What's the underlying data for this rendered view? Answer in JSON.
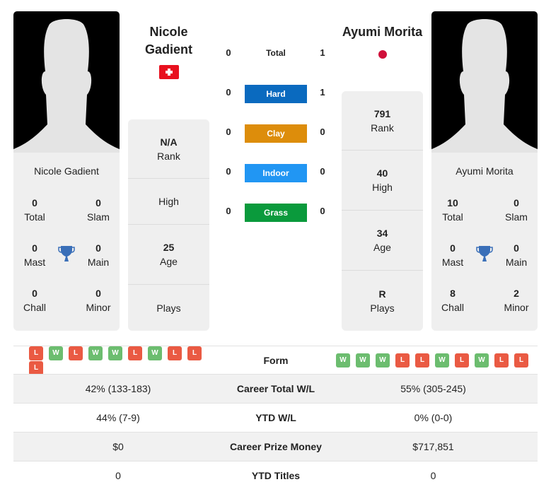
{
  "player1": {
    "name": "Nicole Gadient",
    "name_line1": "Nicole",
    "name_line2": "Gadient",
    "flag": "switzerland-flag",
    "titles": {
      "total": "0",
      "slam": "0",
      "mast": "0",
      "main": "0",
      "chall": "0",
      "minor": "0"
    },
    "rank": "N/A",
    "high": "",
    "age": "25",
    "plays": ""
  },
  "player2": {
    "name": "Ayumi Morita",
    "flag": "japan-flag",
    "titles": {
      "total": "10",
      "slam": "0",
      "mast": "0",
      "main": "0",
      "chall": "8",
      "minor": "2"
    },
    "rank": "791",
    "high": "40",
    "age": "34",
    "plays": "R"
  },
  "labels": {
    "total": "Total",
    "slam": "Slam",
    "mast": "Mast",
    "main": "Main",
    "chall": "Chall",
    "minor": "Minor",
    "rank": "Rank",
    "high": "High",
    "age": "Age",
    "plays": "Plays"
  },
  "h2h": [
    {
      "label": "Total",
      "p1": "0",
      "p2": "1",
      "color": ""
    },
    {
      "label": "Hard",
      "p1": "0",
      "p2": "1",
      "color": "#0a6abf"
    },
    {
      "label": "Clay",
      "p1": "0",
      "p2": "0",
      "color": "#dd8d0b"
    },
    {
      "label": "Indoor",
      "p1": "0",
      "p2": "0",
      "color": "#2196f3"
    },
    {
      "label": "Grass",
      "p1": "0",
      "p2": "0",
      "color": "#0a9a3c"
    }
  ],
  "form": {
    "label": "Form",
    "p1": [
      "L",
      "W",
      "L",
      "W",
      "W",
      "L",
      "W",
      "L",
      "L",
      "L"
    ],
    "p2": [
      "W",
      "W",
      "W",
      "L",
      "L",
      "W",
      "L",
      "W",
      "L",
      "L"
    ],
    "win_color": "#6cbd6f",
    "loss_color": "#ea5a43"
  },
  "comparison": [
    {
      "label": "Career Total W/L",
      "p1": "42% (133-183)",
      "p2": "55% (305-245)"
    },
    {
      "label": "YTD W/L",
      "p1": "44% (7-9)",
      "p2": "0% (0-0)"
    },
    {
      "label": "Career Prize Money",
      "p1": "$0",
      "p2": "$717,851"
    },
    {
      "label": "YTD Titles",
      "p1": "0",
      "p2": "0"
    }
  ]
}
